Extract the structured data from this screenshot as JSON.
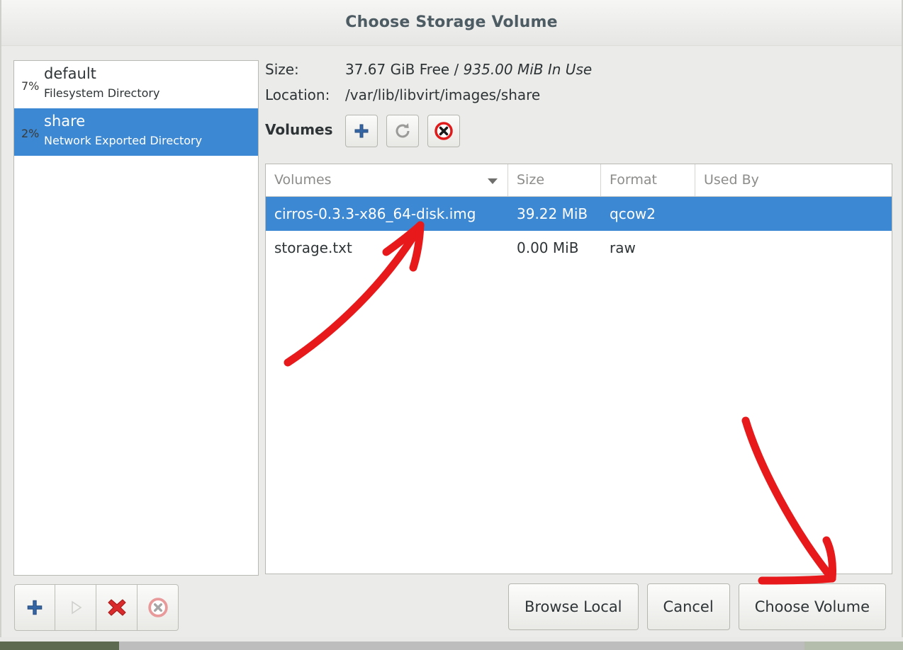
{
  "window": {
    "title": "Choose Storage Volume"
  },
  "pool_list": {
    "items": [
      {
        "percent": "7%",
        "name": "default",
        "type": "Filesystem Directory",
        "selected": false
      },
      {
        "percent": "2%",
        "name": "share",
        "type": "Network Exported Directory",
        "selected": true
      }
    ]
  },
  "details": {
    "size_label": "Size:",
    "size_free": "37.67 GiB Free / ",
    "size_in_use": "935.00 MiB In Use",
    "location_label": "Location:",
    "location_value": "/var/lib/libvirt/images/share"
  },
  "volumes_toolbar": {
    "label": "Volumes",
    "add_icon": "plus-icon",
    "refresh_icon": "refresh-icon",
    "delete_icon": "delete-circle-icon"
  },
  "volume_table": {
    "columns": [
      "Volumes",
      "Size",
      "Format",
      "Used By"
    ],
    "sort_column": "Volumes",
    "rows": [
      {
        "volume": "cirros-0.3.3-x86_64-disk.img",
        "size": "39.22 MiB",
        "format": "qcow2",
        "used_by": "",
        "selected": true
      },
      {
        "volume": "storage.txt",
        "size": "0.00 MiB",
        "format": "raw",
        "used_by": "",
        "selected": false
      }
    ]
  },
  "pool_actions": [
    {
      "icon": "plus-icon",
      "name": "add-pool-button",
      "enabled": true
    },
    {
      "icon": "play-icon",
      "name": "start-pool-button",
      "enabled": false
    },
    {
      "icon": "delete-x-icon",
      "name": "delete-pool-button",
      "enabled": true
    },
    {
      "icon": "stop-circle-icon",
      "name": "stop-pool-button",
      "enabled": false
    }
  ],
  "dialog_buttons": {
    "browse_local": "Browse Local",
    "cancel": "Cancel",
    "choose_volume": "Choose Volume"
  },
  "colors": {
    "selection_blue": "#3d88d2",
    "annotation_red": "#e8191b",
    "title_text": "#4d5b63",
    "dialog_bg": "#ebebe9"
  },
  "annotations": [
    {
      "name": "arrow-to-selected-volume",
      "target": "cirros-0.3.3-x86_64-disk.img"
    },
    {
      "name": "arrow-to-choose-volume-button",
      "target": "Choose Volume"
    }
  ]
}
